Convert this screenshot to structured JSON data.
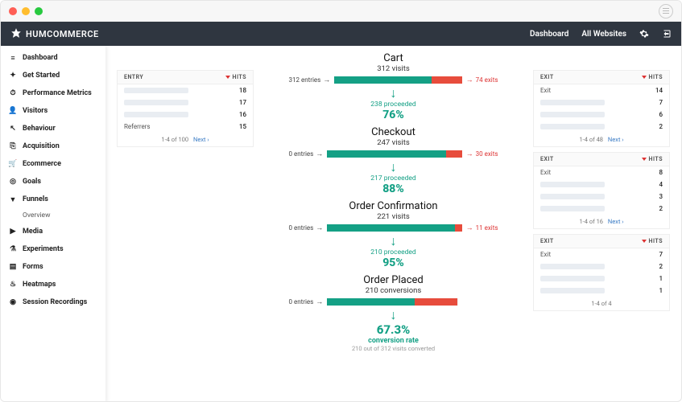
{
  "header": {
    "brand": "HUMCOMMERCE",
    "nav": [
      "Dashboard",
      "All Websites"
    ]
  },
  "sidebar": {
    "items": [
      {
        "icon": "dashboard-icon",
        "label": "Dashboard"
      },
      {
        "icon": "star-icon",
        "label": "Get Started"
      },
      {
        "icon": "gauge-icon",
        "label": "Performance Metrics"
      },
      {
        "icon": "user-icon",
        "label": "Visitors"
      },
      {
        "icon": "pointer-icon",
        "label": "Behaviour"
      },
      {
        "icon": "clipboard-icon",
        "label": "Acquisition"
      },
      {
        "icon": "cart-icon",
        "label": "Ecommerce"
      },
      {
        "icon": "target-icon",
        "label": "Goals"
      },
      {
        "icon": "funnel-icon",
        "label": "Funnels",
        "active": true,
        "sub": [
          "Overview"
        ]
      },
      {
        "icon": "play-icon",
        "label": "Media"
      },
      {
        "icon": "flask-icon",
        "label": "Experiments"
      },
      {
        "icon": "form-icon",
        "label": "Forms"
      },
      {
        "icon": "fire-icon",
        "label": "Heatmaps"
      },
      {
        "icon": "record-icon",
        "label": "Session Recordings"
      }
    ]
  },
  "entryPanel": {
    "title": "ENTRY",
    "hitsLabel": "HITS",
    "rows": [
      {
        "label": "",
        "hits": 18
      },
      {
        "label": "",
        "hits": 17
      },
      {
        "label": "",
        "hits": 16
      },
      {
        "label": "Referrers",
        "hits": 15
      }
    ],
    "pager": "1-4 of 100",
    "next": "Next ›"
  },
  "funnel": {
    "stages": [
      {
        "title": "Cart",
        "sub": "312 visits",
        "entries": "312 entries",
        "exits": "74 exits",
        "greenPct": 76,
        "redPct": 24,
        "proceeded": "238 proceeded",
        "rate": "76%"
      },
      {
        "title": "Checkout",
        "sub": "247 visits",
        "entries": "0 entries",
        "exits": "30 exits",
        "greenPct": 88,
        "redPct": 12,
        "proceeded": "217 proceeded",
        "rate": "88%"
      },
      {
        "title": "Order Confirmation",
        "sub": "221 visits",
        "entries": "0 entries",
        "exits": "11 exits",
        "greenPct": 95,
        "redPct": 5,
        "proceeded": "210 proceeded",
        "rate": "95%"
      },
      {
        "title": "Order Placed",
        "sub": "210 conversions",
        "entries": "0 entries",
        "exits": "",
        "greenPct": 67,
        "redPct": 33
      }
    ],
    "final": {
      "rate": "67.3%",
      "label": "conversion rate",
      "note": "210 out of 312 visits converted"
    }
  },
  "exitPanels": [
    {
      "title": "EXIT",
      "hitsLabel": "HITS",
      "rows": [
        {
          "label": "Exit",
          "hits": 14
        },
        {
          "label": "",
          "hits": 7
        },
        {
          "label": "",
          "hits": 6
        },
        {
          "label": "",
          "hits": 2
        }
      ],
      "pager": "1-4 of 48",
      "next": "Next ›"
    },
    {
      "title": "EXIT",
      "hitsLabel": "HITS",
      "rows": [
        {
          "label": "Exit",
          "hits": 8
        },
        {
          "label": "",
          "hits": 4
        },
        {
          "label": "",
          "hits": 3
        },
        {
          "label": "",
          "hits": 2
        }
      ],
      "pager": "1-4 of 16",
      "next": "Next ›"
    },
    {
      "title": "EXIT",
      "hitsLabel": "HITS",
      "rows": [
        {
          "label": "Exit",
          "hits": 7
        },
        {
          "label": "",
          "hits": 2
        },
        {
          "label": "",
          "hits": 1
        },
        {
          "label": "",
          "hits": 1
        }
      ],
      "pager": "1-4 of 4",
      "next": ""
    }
  ],
  "icons": {
    "dashboard-icon": "≡",
    "star-icon": "✦",
    "gauge-icon": "⏱",
    "user-icon": "👤",
    "pointer-icon": "↖",
    "clipboard-icon": "⎘",
    "cart-icon": "🛒",
    "target-icon": "◎",
    "funnel-icon": "▼",
    "play-icon": "▶",
    "flask-icon": "⚗",
    "form-icon": "▤",
    "fire-icon": "♨",
    "record-icon": "◉"
  }
}
